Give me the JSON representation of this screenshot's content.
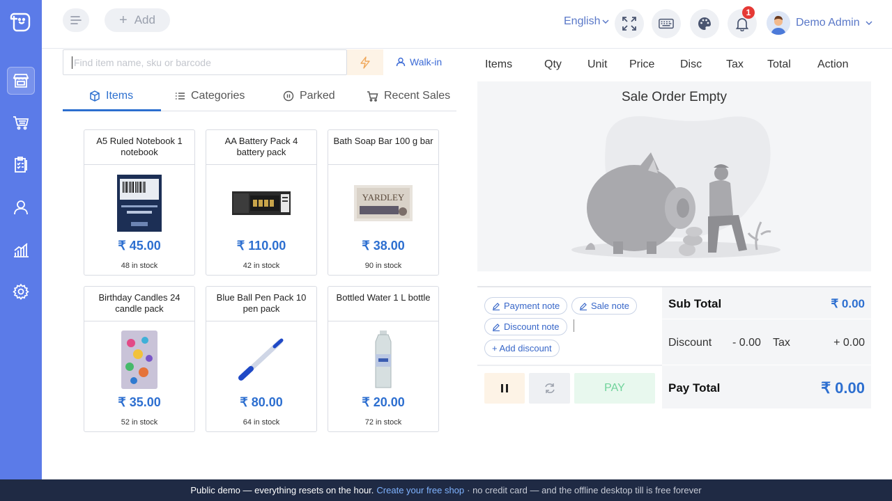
{
  "header": {
    "add_label": "Add",
    "language": "English",
    "notification_count": "1",
    "user_name": "Demo Admin"
  },
  "search": {
    "placeholder": "Find item name, sku or barcode",
    "customer": "Walk-in"
  },
  "tabs": [
    {
      "label": "Items",
      "icon": "cube-icon"
    },
    {
      "label": "Categories",
      "icon": "list-icon"
    },
    {
      "label": "Parked",
      "icon": "pause-circle-icon"
    },
    {
      "label": "Recent Sales",
      "icon": "cart-icon"
    }
  ],
  "products": [
    {
      "name": "A5 Ruled Notebook 1 notebook",
      "price": "₹ 45.00",
      "stock": "48 in stock"
    },
    {
      "name": "AA Battery Pack 4 battery pack",
      "price": "₹ 110.00",
      "stock": "42 in stock"
    },
    {
      "name": "Bath Soap Bar 100 g bar",
      "price": "₹ 38.00",
      "stock": "90 in stock"
    },
    {
      "name": "Birthday Candles 24 candle pack",
      "price": "₹ 35.00",
      "stock": "52 in stock"
    },
    {
      "name": "Blue Ball Pen Pack 10 pen pack",
      "price": "₹ 80.00",
      "stock": "64 in stock"
    },
    {
      "name": "Bottled Water 1 L bottle",
      "price": "₹ 20.00",
      "stock": "72 in stock"
    }
  ],
  "cart": {
    "columns": [
      "Items",
      "Qty",
      "Unit",
      "Price",
      "Disc",
      "Tax",
      "Total",
      "Action"
    ],
    "empty_text": "Sale Order Empty"
  },
  "notes": {
    "payment_note": "Payment note",
    "sale_note": "Sale note",
    "discount_note": "Discount note",
    "add_discount": "+ Add discount"
  },
  "totals": {
    "sub_total_label": "Sub Total",
    "sub_total": "₹ 0.00",
    "discount_label": "Discount",
    "discount": "- 0.00",
    "tax_label": "Tax",
    "tax": "+ 0.00",
    "pay_total_label": "Pay Total",
    "pay_total": "₹ 0.00"
  },
  "actions": {
    "pay_label": "PAY"
  },
  "footer": {
    "text1": "Public demo — everything resets on the hour.",
    "link": "Create your free shop",
    "text2": "· no credit card — and the offline desktop till is free forever"
  },
  "colors": {
    "sidebar": "#5b7be8",
    "accent": "#2d6fd0",
    "footer": "#1f2a44"
  }
}
